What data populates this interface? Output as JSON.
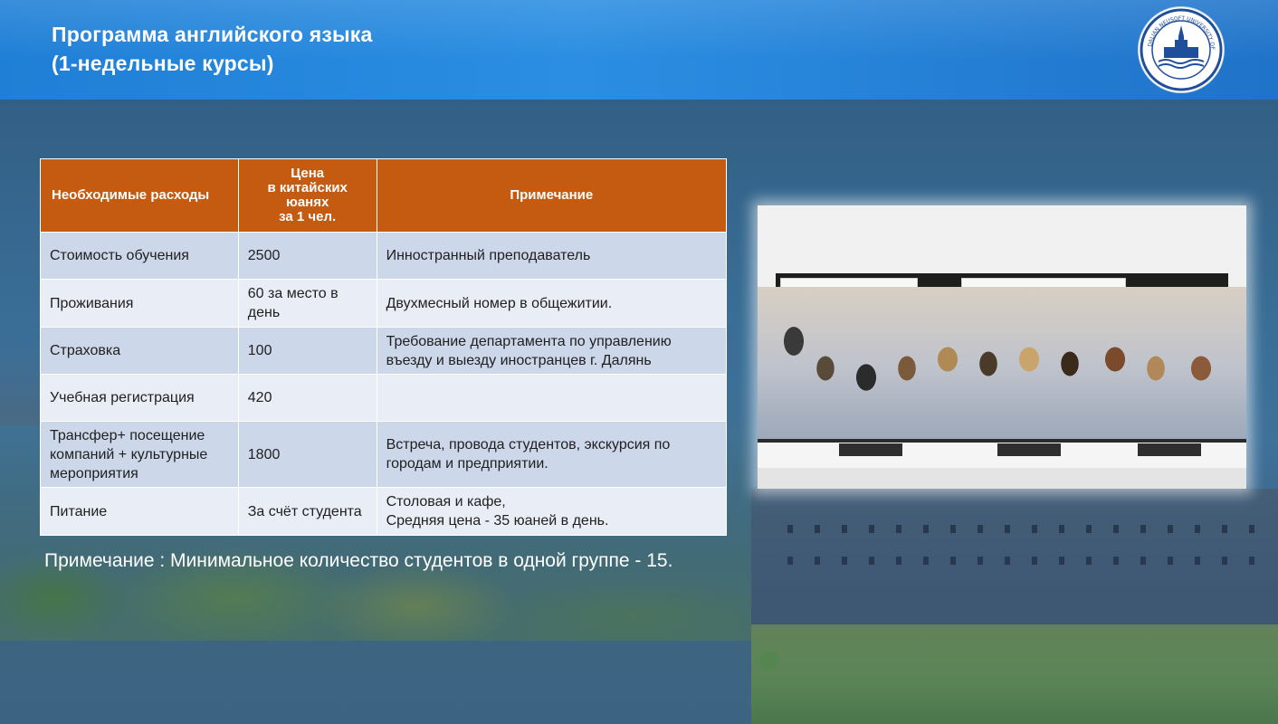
{
  "slide": {
    "title_line1": "Программа английского языка",
    "title_line2": "(1-недельные курсы)",
    "logo": {
      "icon": "university-seal-icon",
      "text": "DALIAN NEUSOFT UNIVERSITY OF INFORMATION"
    },
    "table": {
      "headers": {
        "col1": "Необходимые расходы",
        "col2_line1": "Цена",
        "col2_line2": "в китайских",
        "col2_line3": "юанях",
        "col2_line4": "за 1 чел.",
        "col3": "Примечание"
      },
      "rows": [
        {
          "item": "Стоимость обучения",
          "price": "2500",
          "note": "Инностранный преподаватель"
        },
        {
          "item": "Проживания",
          "price": "60 за место в день",
          "note": "Двухмесный номер в общежитии."
        },
        {
          "item": "Страховка",
          "price": "100",
          "note": "Требование департамента по управлению въезду и выезду иностранцев г. Далянь"
        },
        {
          "item": "Учебная регистрация",
          "price": "420",
          "note": ""
        },
        {
          "item": "Трансфер+ посещение компаний + культурные мероприятия",
          "price": "1800",
          "note": "Встреча, провода студентов, экскурсия по городам и предприятии."
        },
        {
          "item": "Питание",
          "price": "За счёт студента",
          "note_line1": "Столовая и кафе,",
          "note_line2": "Средняя цена - 35 юаней в день."
        }
      ]
    },
    "footnote": "Примечание : Минимальное количество студентов в одной группе - 15.",
    "colors": {
      "header_bar": "#1f7fd6",
      "table_header": "#c55a11",
      "row_dark": "#cdd7ea",
      "row_light": "#e9edf5"
    },
    "photo": {
      "icon": "group-photo-icon"
    }
  }
}
